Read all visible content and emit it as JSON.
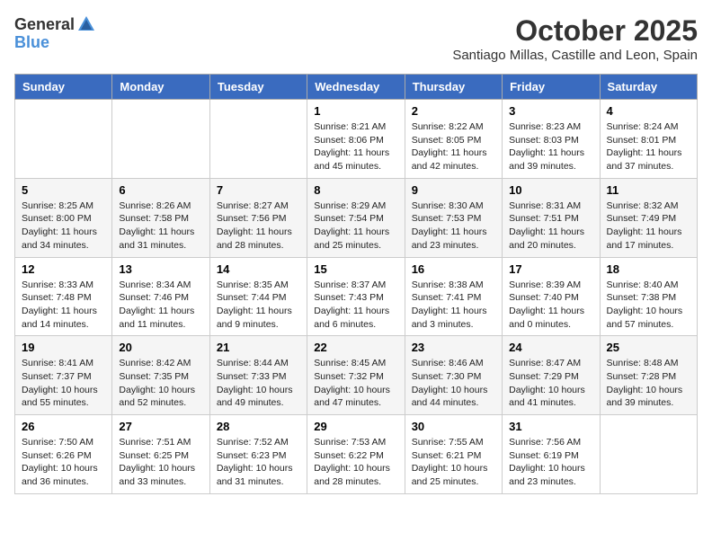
{
  "logo": {
    "text_general": "General",
    "text_blue": "Blue"
  },
  "title": "October 2025",
  "subtitle": "Santiago Millas, Castille and Leon, Spain",
  "weekdays": [
    "Sunday",
    "Monday",
    "Tuesday",
    "Wednesday",
    "Thursday",
    "Friday",
    "Saturday"
  ],
  "weeks": [
    [
      {
        "day": "",
        "sunrise": "",
        "sunset": "",
        "daylight": ""
      },
      {
        "day": "",
        "sunrise": "",
        "sunset": "",
        "daylight": ""
      },
      {
        "day": "",
        "sunrise": "",
        "sunset": "",
        "daylight": ""
      },
      {
        "day": "1",
        "sunrise": "Sunrise: 8:21 AM",
        "sunset": "Sunset: 8:06 PM",
        "daylight": "Daylight: 11 hours and 45 minutes."
      },
      {
        "day": "2",
        "sunrise": "Sunrise: 8:22 AM",
        "sunset": "Sunset: 8:05 PM",
        "daylight": "Daylight: 11 hours and 42 minutes."
      },
      {
        "day": "3",
        "sunrise": "Sunrise: 8:23 AM",
        "sunset": "Sunset: 8:03 PM",
        "daylight": "Daylight: 11 hours and 39 minutes."
      },
      {
        "day": "4",
        "sunrise": "Sunrise: 8:24 AM",
        "sunset": "Sunset: 8:01 PM",
        "daylight": "Daylight: 11 hours and 37 minutes."
      }
    ],
    [
      {
        "day": "5",
        "sunrise": "Sunrise: 8:25 AM",
        "sunset": "Sunset: 8:00 PM",
        "daylight": "Daylight: 11 hours and 34 minutes."
      },
      {
        "day": "6",
        "sunrise": "Sunrise: 8:26 AM",
        "sunset": "Sunset: 7:58 PM",
        "daylight": "Daylight: 11 hours and 31 minutes."
      },
      {
        "day": "7",
        "sunrise": "Sunrise: 8:27 AM",
        "sunset": "Sunset: 7:56 PM",
        "daylight": "Daylight: 11 hours and 28 minutes."
      },
      {
        "day": "8",
        "sunrise": "Sunrise: 8:29 AM",
        "sunset": "Sunset: 7:54 PM",
        "daylight": "Daylight: 11 hours and 25 minutes."
      },
      {
        "day": "9",
        "sunrise": "Sunrise: 8:30 AM",
        "sunset": "Sunset: 7:53 PM",
        "daylight": "Daylight: 11 hours and 23 minutes."
      },
      {
        "day": "10",
        "sunrise": "Sunrise: 8:31 AM",
        "sunset": "Sunset: 7:51 PM",
        "daylight": "Daylight: 11 hours and 20 minutes."
      },
      {
        "day": "11",
        "sunrise": "Sunrise: 8:32 AM",
        "sunset": "Sunset: 7:49 PM",
        "daylight": "Daylight: 11 hours and 17 minutes."
      }
    ],
    [
      {
        "day": "12",
        "sunrise": "Sunrise: 8:33 AM",
        "sunset": "Sunset: 7:48 PM",
        "daylight": "Daylight: 11 hours and 14 minutes."
      },
      {
        "day": "13",
        "sunrise": "Sunrise: 8:34 AM",
        "sunset": "Sunset: 7:46 PM",
        "daylight": "Daylight: 11 hours and 11 minutes."
      },
      {
        "day": "14",
        "sunrise": "Sunrise: 8:35 AM",
        "sunset": "Sunset: 7:44 PM",
        "daylight": "Daylight: 11 hours and 9 minutes."
      },
      {
        "day": "15",
        "sunrise": "Sunrise: 8:37 AM",
        "sunset": "Sunset: 7:43 PM",
        "daylight": "Daylight: 11 hours and 6 minutes."
      },
      {
        "day": "16",
        "sunrise": "Sunrise: 8:38 AM",
        "sunset": "Sunset: 7:41 PM",
        "daylight": "Daylight: 11 hours and 3 minutes."
      },
      {
        "day": "17",
        "sunrise": "Sunrise: 8:39 AM",
        "sunset": "Sunset: 7:40 PM",
        "daylight": "Daylight: 11 hours and 0 minutes."
      },
      {
        "day": "18",
        "sunrise": "Sunrise: 8:40 AM",
        "sunset": "Sunset: 7:38 PM",
        "daylight": "Daylight: 10 hours and 57 minutes."
      }
    ],
    [
      {
        "day": "19",
        "sunrise": "Sunrise: 8:41 AM",
        "sunset": "Sunset: 7:37 PM",
        "daylight": "Daylight: 10 hours and 55 minutes."
      },
      {
        "day": "20",
        "sunrise": "Sunrise: 8:42 AM",
        "sunset": "Sunset: 7:35 PM",
        "daylight": "Daylight: 10 hours and 52 minutes."
      },
      {
        "day": "21",
        "sunrise": "Sunrise: 8:44 AM",
        "sunset": "Sunset: 7:33 PM",
        "daylight": "Daylight: 10 hours and 49 minutes."
      },
      {
        "day": "22",
        "sunrise": "Sunrise: 8:45 AM",
        "sunset": "Sunset: 7:32 PM",
        "daylight": "Daylight: 10 hours and 47 minutes."
      },
      {
        "day": "23",
        "sunrise": "Sunrise: 8:46 AM",
        "sunset": "Sunset: 7:30 PM",
        "daylight": "Daylight: 10 hours and 44 minutes."
      },
      {
        "day": "24",
        "sunrise": "Sunrise: 8:47 AM",
        "sunset": "Sunset: 7:29 PM",
        "daylight": "Daylight: 10 hours and 41 minutes."
      },
      {
        "day": "25",
        "sunrise": "Sunrise: 8:48 AM",
        "sunset": "Sunset: 7:28 PM",
        "daylight": "Daylight: 10 hours and 39 minutes."
      }
    ],
    [
      {
        "day": "26",
        "sunrise": "Sunrise: 7:50 AM",
        "sunset": "Sunset: 6:26 PM",
        "daylight": "Daylight: 10 hours and 36 minutes."
      },
      {
        "day": "27",
        "sunrise": "Sunrise: 7:51 AM",
        "sunset": "Sunset: 6:25 PM",
        "daylight": "Daylight: 10 hours and 33 minutes."
      },
      {
        "day": "28",
        "sunrise": "Sunrise: 7:52 AM",
        "sunset": "Sunset: 6:23 PM",
        "daylight": "Daylight: 10 hours and 31 minutes."
      },
      {
        "day": "29",
        "sunrise": "Sunrise: 7:53 AM",
        "sunset": "Sunset: 6:22 PM",
        "daylight": "Daylight: 10 hours and 28 minutes."
      },
      {
        "day": "30",
        "sunrise": "Sunrise: 7:55 AM",
        "sunset": "Sunset: 6:21 PM",
        "daylight": "Daylight: 10 hours and 25 minutes."
      },
      {
        "day": "31",
        "sunrise": "Sunrise: 7:56 AM",
        "sunset": "Sunset: 6:19 PM",
        "daylight": "Daylight: 10 hours and 23 minutes."
      },
      {
        "day": "",
        "sunrise": "",
        "sunset": "",
        "daylight": ""
      }
    ]
  ]
}
